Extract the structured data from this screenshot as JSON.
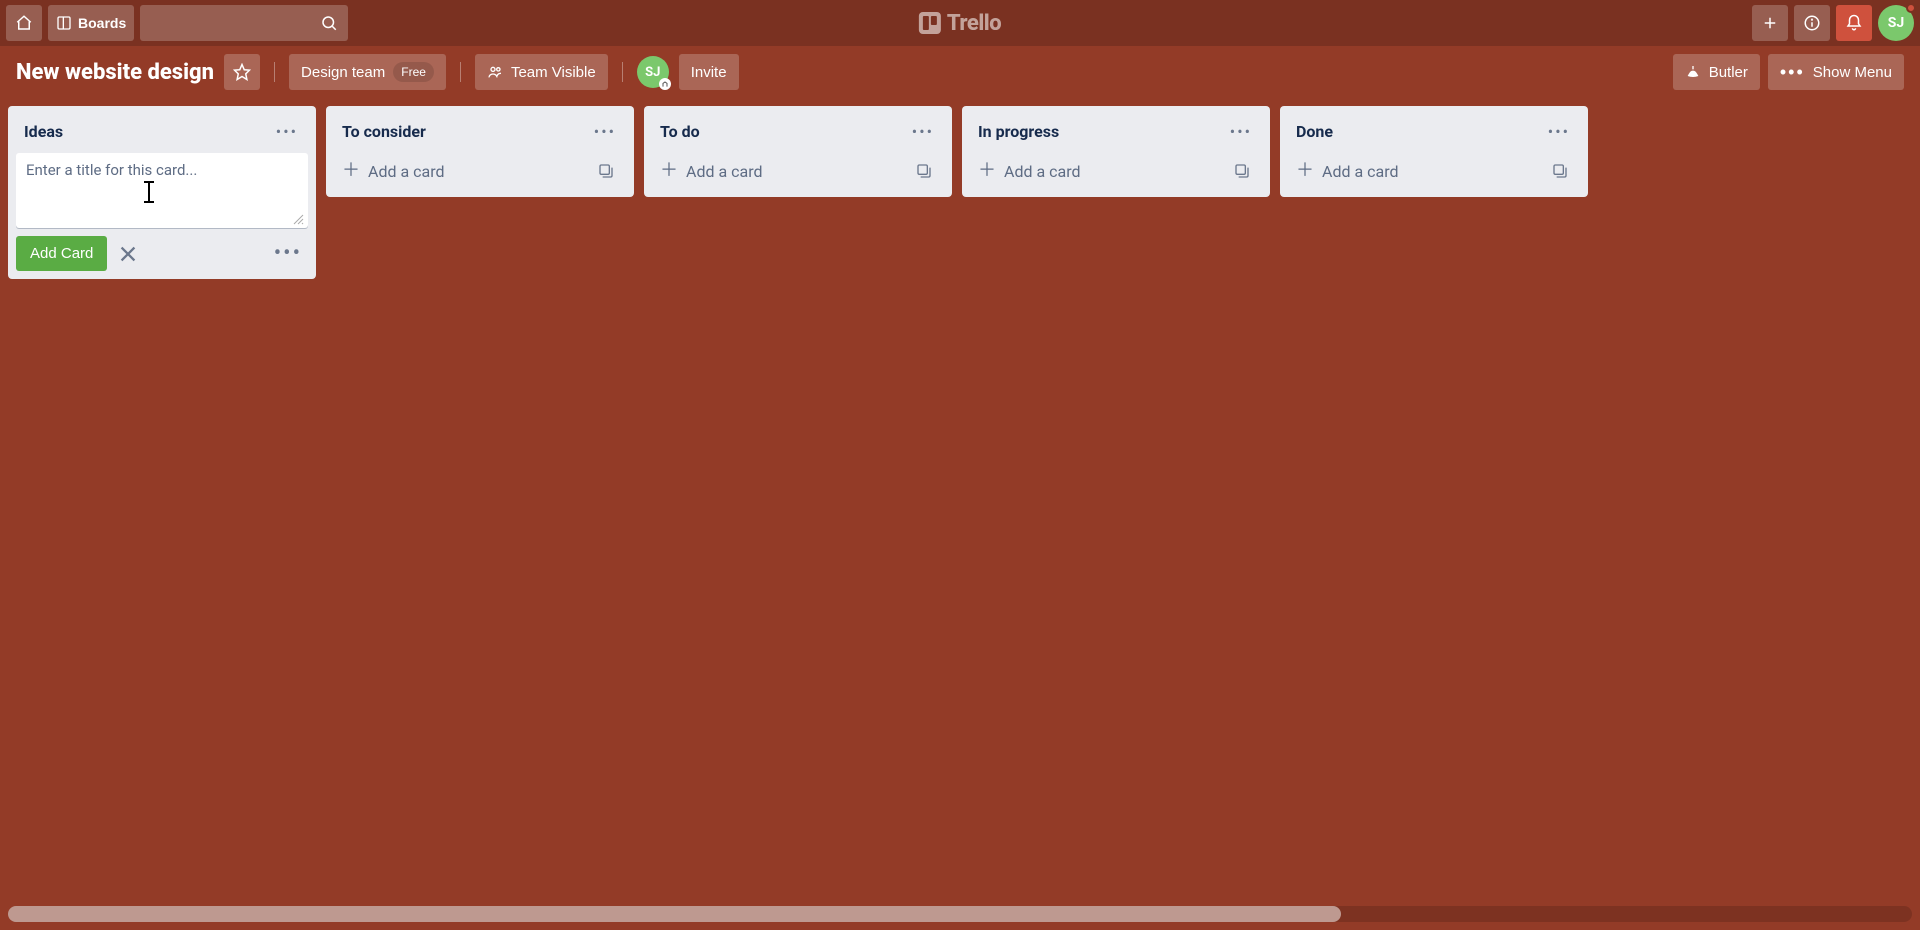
{
  "header": {
    "boards_label": "Boards",
    "logo_text": "Trello",
    "avatar_initials": "SJ"
  },
  "board": {
    "name": "New website design",
    "team_name": "Design team",
    "plan_badge": "Free",
    "team_visible_label": "Team Visible",
    "invite_label": "Invite",
    "member_initials": "SJ",
    "butler_label": "Butler",
    "show_menu_label": "Show Menu"
  },
  "composer": {
    "placeholder": "Enter a title for this card...",
    "value": "",
    "add_button_label": "Add Card"
  },
  "lists": [
    {
      "title": "Ideas",
      "composer_open": true
    },
    {
      "title": "To consider",
      "composer_open": false
    },
    {
      "title": "To do",
      "composer_open": false
    },
    {
      "title": "In progress",
      "composer_open": false
    },
    {
      "title": "Done",
      "composer_open": false
    }
  ],
  "add_card_label": "Add a card"
}
